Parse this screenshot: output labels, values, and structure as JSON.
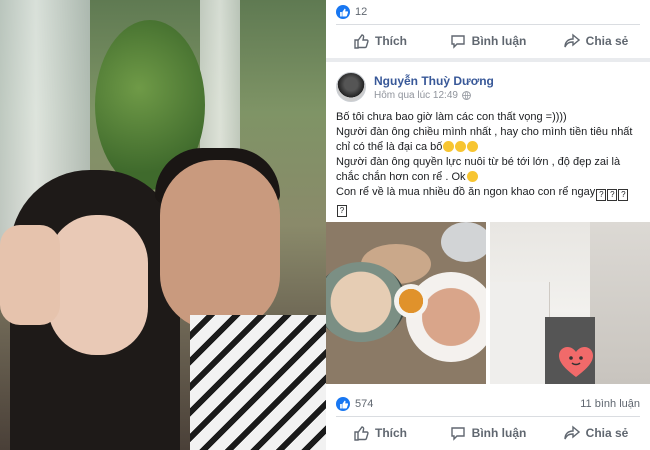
{
  "top_card": {
    "like_count": "12",
    "actions": {
      "like": "Thích",
      "comment": "Bình luận",
      "share": "Chia sẻ"
    }
  },
  "post": {
    "author": "Nguyễn Thuỳ Dương",
    "time": "Hôm qua lúc 12:49",
    "lines": [
      "Bố tôi chưa bao giờ làm các con thất vọng =))))",
      "Người đàn ông chiều mình nhất , hay cho mình tiền tiêu nhất chỉ có thể là đại ca bố",
      "Người đàn ông quyền lực nuôi từ bé tới lớn , độ đẹp zai là chắc chắn hơn con rể . Ok",
      "Con rể về là mua nhiều đồ ăn ngon khao con rể ngay"
    ],
    "like_count": "574",
    "comment_count": "11 bình luận",
    "actions": {
      "like": "Thích",
      "comment": "Bình luận",
      "share": "Chia sẻ"
    }
  },
  "colors": {
    "link": "#385898",
    "like_blue": "#1877f2",
    "muted": "#606770"
  }
}
